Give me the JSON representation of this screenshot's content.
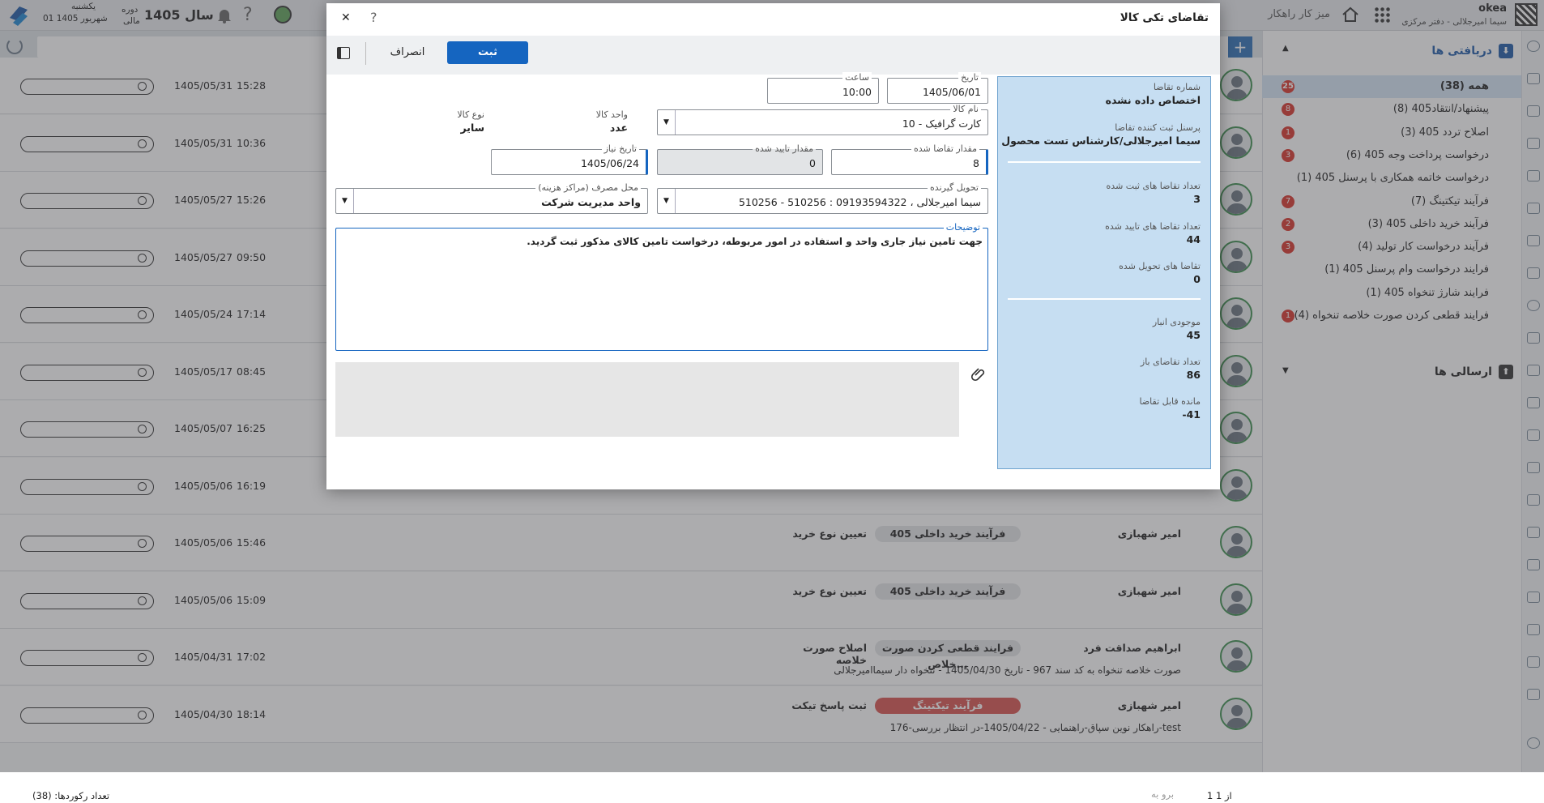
{
  "topbar": {
    "user_name": "okea",
    "user_subtitle": "سیما امیرجلالی - دفتر مرکزی",
    "home_label": "میز کار راهکار",
    "year_label": "سال 1405",
    "period_label": "دوره",
    "period_sub": "مالی",
    "day_name": "یکشنبه",
    "date_label": "01 شهریور 1405"
  },
  "panel": {
    "inbox_title": "دریافتی ها",
    "outbox_title": "ارسالی ها",
    "items": [
      {
        "label": "همه (38)",
        "badge": "25"
      },
      {
        "label": "پیشنهاد/انتقاد405 (8)",
        "badge": "8"
      },
      {
        "label": "اصلاح تردد 405 (3)",
        "badge": "1"
      },
      {
        "label": "درخواست پرداخت وجه 405 (6)",
        "badge": "3"
      },
      {
        "label": "درخواست خاتمه همکاری با پرسنل 405 (1)",
        "badge": ""
      },
      {
        "label": "فرآیند تیکتینگ (7)",
        "badge": "7"
      },
      {
        "label": "فرآیند خرید داخلی 405 (3)",
        "badge": "2"
      },
      {
        "label": "فرآیند درخواست کار تولید (4)",
        "badge": "3"
      },
      {
        "label": "فرایند درخواست وام پرسنل 405 (1)",
        "badge": ""
      },
      {
        "label": "فرایند شارژ تنخواه 405 (1)",
        "badge": ""
      },
      {
        "label": "فرایند قطعی کردن صورت خلاصه تنخواه (4)",
        "badge": "1"
      }
    ]
  },
  "rows": [
    {
      "date": "1405/05/31",
      "time": "15:28",
      "sender": "",
      "chip": "",
      "action": "",
      "sub": ""
    },
    {
      "date": "1405/05/31",
      "time": "10:36",
      "sender": "",
      "chip": "",
      "action": "",
      "sub": ""
    },
    {
      "date": "1405/05/27",
      "time": "15:26",
      "sender": "",
      "chip": "",
      "action": "",
      "sub": ""
    },
    {
      "date": "1405/05/27",
      "time": "09:50",
      "sender": "",
      "chip": "",
      "action": "",
      "sub": ""
    },
    {
      "date": "1405/05/24",
      "time": "17:14",
      "sender": "",
      "chip": "",
      "action": "",
      "sub": ""
    },
    {
      "date": "1405/05/17",
      "time": "08:45",
      "sender": "",
      "chip": "",
      "action": "",
      "sub": ""
    },
    {
      "date": "1405/05/07",
      "time": "16:25",
      "sender": "",
      "chip": "",
      "action": "",
      "sub": ""
    },
    {
      "date": "1405/05/06",
      "time": "16:19",
      "sender": "",
      "chip": "",
      "action": "",
      "sub": ""
    },
    {
      "date": "1405/05/06",
      "time": "15:46",
      "sender": "امیر شهبازی",
      "chip": "فرآیند خرید داخلی 405",
      "action": "تعیین نوع خرید",
      "sub": ""
    },
    {
      "date": "1405/05/06",
      "time": "15:09",
      "sender": "امیر شهبازی",
      "chip": "فرآیند خرید داخلی 405",
      "action": "تعیین نوع خرید",
      "sub": ""
    },
    {
      "date": "1405/04/31",
      "time": "17:02",
      "sender": "ابراهیم صداقت فرد",
      "chip": "فرایند قطعی کردن صورت خلاص...",
      "action": "اصلاح صورت خلاصه",
      "sub": "صورت خلاصه تنخواه به کد سند 967 - تاریخ 1405/04/30 - تنخواه دار سیماامیرجلالی"
    },
    {
      "date": "1405/04/30",
      "time": "18:14",
      "sender": "امیر شهبازی",
      "chip": "فرآیند تیکتینگ",
      "action": "ثبت پاسخ تیکت",
      "sub": "176-راهکار نوین سپاق-راهنمایی - 1405/04/22-در انتظار بررسی-test"
    }
  ],
  "footer": {
    "count_label": "تعداد رکوردها: (38)",
    "page_label": "1 از 1",
    "goto_label": "برو به"
  },
  "dialog": {
    "title": "تقاضای تکی کالا",
    "submit_label": "ثبت",
    "cancel_label": "انصراف",
    "help_label": "?",
    "close_label": "✕",
    "info": {
      "request_no_label": "شماره تقاضا",
      "request_no_value": "اختصاص داده نشده",
      "requester_label": "پرسنل ثبت کننده تقاضا",
      "requester_value": "سیما امیرجلالی/کارشناس تست محصول",
      "registered_label": "تعداد تقاضا های ثبت شده",
      "registered_value": "3",
      "approved_label": "تعداد تقاضا های تایید شده",
      "approved_value": "44",
      "delivered_label": "تقاضا های تحویل شده",
      "delivered_value": "0",
      "stock_label": "موجودی انبار",
      "stock_value": "45",
      "open_label": "تعداد تقاضای باز",
      "open_value": "86",
      "remaining_label": "مانده قابل تقاضا",
      "remaining_value": "-41"
    },
    "fields": {
      "date_label": "تاریخ",
      "date_value": "1405/06/01",
      "time_label": "ساعت",
      "time_value": "10:00",
      "item_label": "نام کالا",
      "item_value": "10 - کارت گرافیک",
      "unit_label": "واحد کالا",
      "unit_value": "عدد",
      "type_label": "نوع کالا",
      "type_value": "سایر",
      "qty_label": "مقدار تقاضا شده",
      "qty_value": "8",
      "approved_qty_label": "مقدار تایید شده",
      "approved_qty_value": "0",
      "need_date_label": "تاریخ نیاز",
      "need_date_value": "1405/06/24",
      "receiver_label": "تحویل گیرنده",
      "receiver_value": "510256 - 510256 : سیما امیرجلالی ، 09193594322",
      "cost_center_label": "محل مصرف (مراکز هزینه)",
      "cost_center_value": "واحد مدیریت شرکت",
      "desc_label": "توضیحات",
      "desc_value": "جهت تامین نیاز جاری واحد و استفاده در امور مربوطه، درخواست تامین کالای مذکور ثبت گردید."
    }
  }
}
